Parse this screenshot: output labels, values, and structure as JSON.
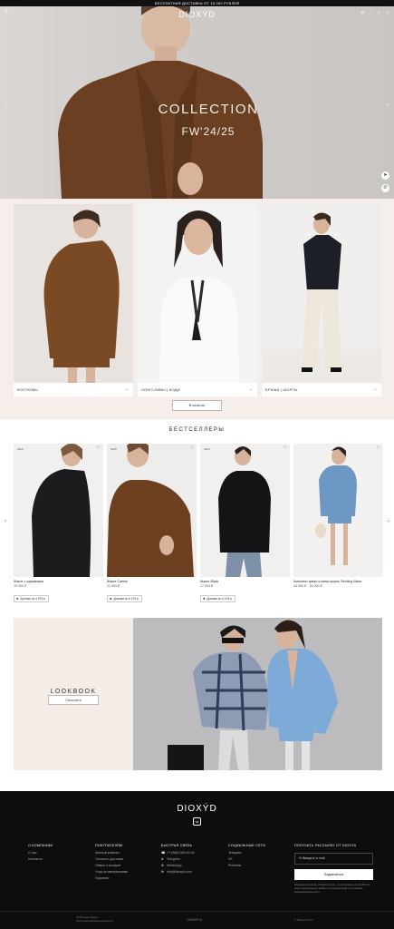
{
  "promo": "БЕСПЛАТНАЯ ДОСТАВКА ОТ 15 000 РУБЛЕЙ",
  "brand": "DIOXÝD",
  "hero": {
    "title": "COLLECTION",
    "subtitle": "FW'24/25"
  },
  "categories": [
    {
      "label": "КОСТЮМЫ"
    },
    {
      "label": "ЛОНГСЛИВЫ | БОДИ"
    },
    {
      "label": "БРЮКИ | ШОРТЫ"
    }
  ],
  "catalog_button": "В каталог",
  "bestsellers": {
    "title": "БЕСТСЕЛЛЕРЫ",
    "products": [
      {
        "tag": "NEW",
        "name": "Жакет с карманами",
        "price": "19 900 ₽",
        "split": "Долями по 4 975 ₽"
      },
      {
        "tag": "NEW",
        "name": "Жакет Carmel",
        "price": "21 900 ₽",
        "split": "Долями по 5 475 ₽"
      },
      {
        "tag": "NEW",
        "name": "Жакет Black",
        "price": "17 900 ₽",
        "split": "Долями по 4 475 ₽"
      },
      {
        "tag": "",
        "name": "Комплект жакет и мини-шорты Stretchy Wave",
        "price": "25 050 ₽ · 34 000 ₽",
        "split": ""
      }
    ]
  },
  "lookbook": {
    "title": "LOOKBOOK",
    "button": "Смотреть"
  },
  "footer": {
    "columns": [
      {
        "heading": "О КОМПАНИИ",
        "items": [
          "О нас",
          "Контакты"
        ]
      },
      {
        "heading": "ПОКУПАТЕЛЯМ",
        "items": [
          "Личный кабинет",
          "Оплата и доставка",
          "Обмен и возврат",
          "Уход за материалами",
          "Гарантии"
        ]
      },
      {
        "heading": "БЫСТРАЯ СВЯЗЬ",
        "items": [
          "+7 (985) 000-00-00",
          "Telegram",
          "WhatsApp",
          "info@dioxyd.com"
        ]
      },
      {
        "heading": "СОЦИАЛЬНЫЕ СЕТИ",
        "items": [
          "Telegram",
          "VK",
          "Pinterest"
        ]
      }
    ],
    "newsletter": {
      "heading": "ПОЛУЧАТЬ РАССЫЛКУ ОТ DIOXYD",
      "placeholder": "Введите e-mail",
      "button": "Подписаться",
      "note": "Нажимая на кнопку «Подписаться», я соглашаюсь на обработку моих персональных данных и ознакомлен(а) с условиями конфиденциальности"
    },
    "bottom_left_1": "Публичная оферта",
    "bottom_left_2": "Политика конфиденциальности",
    "bottom_mid": "GRAMPUS",
    "bottom_right": "© 2024 DIOXYD"
  }
}
